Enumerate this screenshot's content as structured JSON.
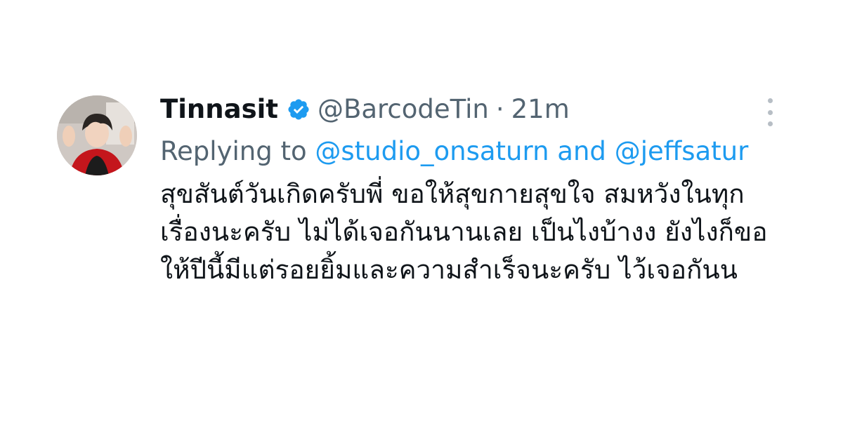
{
  "tweet": {
    "display_name": "Tinnasit",
    "handle": "@BarcodeTin",
    "separator": "·",
    "time": "21m",
    "replying_prefix": "Replying to",
    "reply_mention_1": "@studio_onsaturn",
    "reply_conjunction": "and",
    "reply_mention_2": "@jeffsatur",
    "text": "สุขสันต์วันเกิดครับพี่ ขอให้สุขกายสุขใจ สมหวังในทุกเรื่องนะครับ ไม่ได้เจอกันนานเลย เป็นไงบ้างง ยังไงก็ขอให้ปีนี้มีแต่รอยยิ้มและความสำเร็จนะครับ ไว้เจอกันน"
  },
  "icons": {
    "verified": "verified-badge-icon",
    "more": "more-options-icon",
    "avatar": "avatar-photo"
  },
  "colors": {
    "text_primary": "#0f1419",
    "text_secondary": "#536471",
    "accent": "#1d9bf0",
    "background": "#ffffff"
  }
}
